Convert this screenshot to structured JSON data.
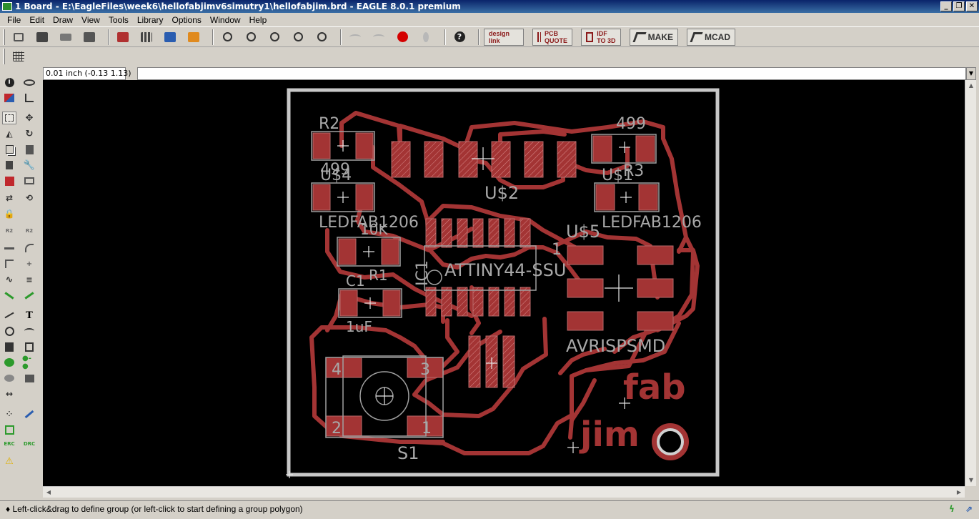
{
  "window": {
    "title": "1 Board - E:\\EagleFiles\\week6\\hellofabjimv6simutry1\\hellofabjim.brd - EAGLE 8.0.1 premium",
    "minimize": "_",
    "restore": "❐",
    "close": "✕"
  },
  "menu": [
    "File",
    "Edit",
    "Draw",
    "View",
    "Tools",
    "Library",
    "Options",
    "Window",
    "Help"
  ],
  "toolbar": {
    "icons": [
      "open-icon",
      "save-icon",
      "print-icon",
      "cam-icon",
      "schematic-icon",
      "library-icon",
      "script-icon",
      "ulp-icon",
      "zoom-fit-icon",
      "zoom-in-icon",
      "zoom-out-icon",
      "zoom-select-icon",
      "zoom-redraw-icon",
      "undo-icon",
      "redo-icon",
      "stop-icon",
      "go-icon",
      "help-icon"
    ],
    "stop_color": "#d40000",
    "design_link": "design link",
    "pcb_quote": "PCB QUOTE",
    "idf_3d": "IDF TO 3D",
    "make": "MAKE",
    "mcad": "MCAD"
  },
  "command": {
    "coordinate": "0.01 inch (-0.13 1.13)",
    "value": "",
    "placeholder": ""
  },
  "board": {
    "colors": {
      "copper": "#a33434",
      "outline": "#c8c8c8",
      "silk": "#a0a0a0",
      "background": "#000000"
    },
    "labels": {
      "r2_name": "R2",
      "r2_value": "499",
      "u4_name": "U$4",
      "u4_value": "LEDFAB1206",
      "r1_value": "10K",
      "r1_name": "R1",
      "c1_name": "C1",
      "c1_value": "1uF",
      "u2_name": "U$2",
      "r3_value": "499",
      "r3_name": "R3",
      "u1_name": "U$1",
      "u1_value": "LEDFAB1206",
      "u5_name": "U$5",
      "pin1": "1",
      "ic1_name": "IC1",
      "ic1_value": "ATTINY44-SSU",
      "isp_value": "AVRISPSMD",
      "s1_name": "S1",
      "pad4": "4",
      "pad3": "3",
      "pad2": "2",
      "pad1": "1",
      "fab": "fab",
      "jim": "jim"
    }
  },
  "status": {
    "message": "♦ Left-click&drag to define group (or left-click to start defining a group polygon)"
  }
}
